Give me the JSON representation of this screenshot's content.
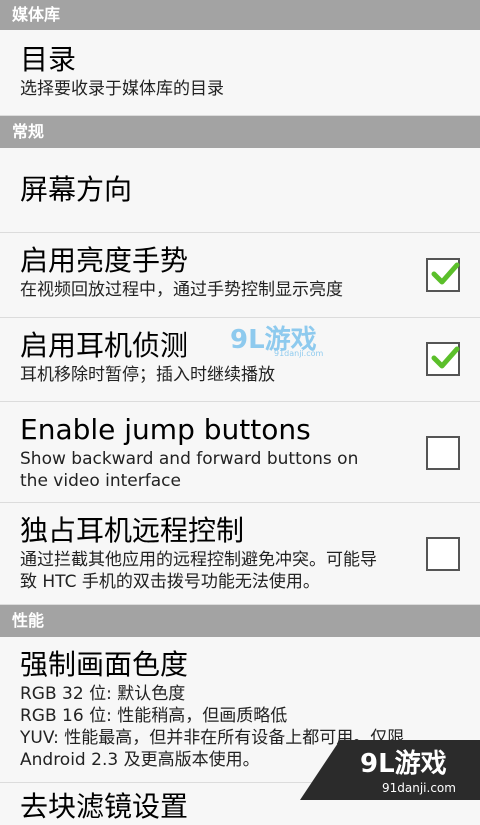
{
  "sections": {
    "media_library": "媒体库",
    "general": "常规",
    "performance": "性能"
  },
  "items": {
    "directory": {
      "title": "目录",
      "summary": "选择要收录于媒体库的目录"
    },
    "orientation": {
      "title": "屏幕方向"
    },
    "brightness": {
      "title": "启用亮度手势",
      "summary": "在视频回放过程中，通过手势控制显示亮度",
      "checked": true
    },
    "headset": {
      "title": "启用耳机侦测",
      "summary": "耳机移除时暂停；插入时继续播放",
      "checked": true
    },
    "jump": {
      "title": "Enable jump buttons",
      "summary": "Show backward and forward buttons on the video interface",
      "checked": false
    },
    "remote": {
      "title": "独占耳机远程控制",
      "summary": "通过拦截其他应用的远程控制避免冲突。可能导致 HTC 手机的双击拨号功能无法使用。",
      "checked": false
    },
    "chroma": {
      "title": "强制画面色度",
      "lines": [
        "RGB 32 位: 默认色度",
        "RGB 16 位: 性能稍高，但画质略低",
        "YUV: 性能最高，但并非在所有设备上都可用。仅限",
        "Android 2.3 及更高版本使用。"
      ]
    },
    "next": {
      "title": "去块滤镜设置"
    }
  },
  "watermark": {
    "mid_logo": "9L游戏",
    "mid_url": "91danji.com",
    "corner_logo": "9L游戏",
    "corner_url": "91danji.com"
  },
  "colors": {
    "header_bg": "#a3a3a3",
    "check_green": "#5bbf2a"
  }
}
